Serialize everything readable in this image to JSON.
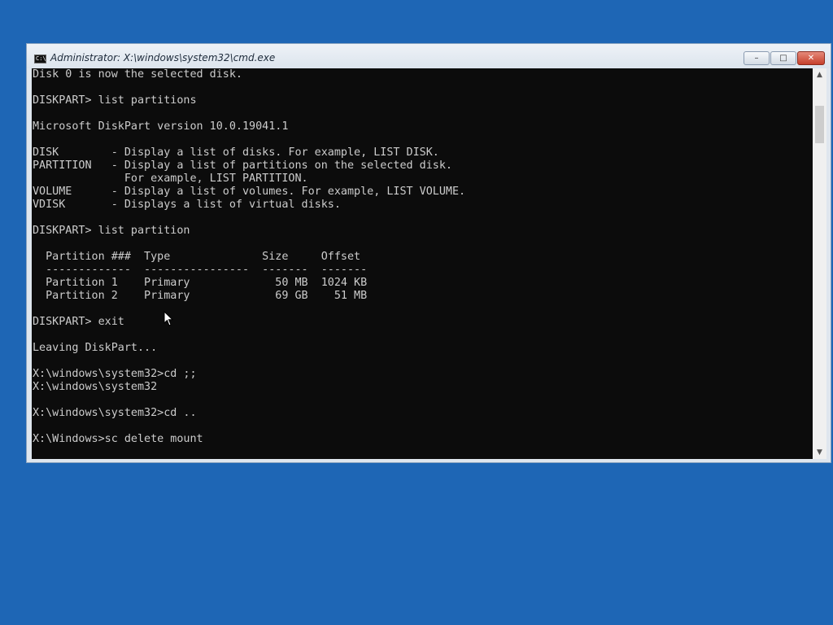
{
  "window": {
    "title": "Administrator: X:\\windows\\system32\\cmd.exe",
    "icon_label": "C:\\",
    "min_glyph": "–",
    "max_glyph": "□",
    "close_glyph": "✕"
  },
  "terminal": {
    "lines": [
      "Disk 0 is now the selected disk.",
      "",
      "DISKPART> list partitions",
      "",
      "Microsoft DiskPart version 10.0.19041.1",
      "",
      "DISK        - Display a list of disks. For example, LIST DISK.",
      "PARTITION   - Display a list of partitions on the selected disk.",
      "              For example, LIST PARTITION.",
      "VOLUME      - Display a list of volumes. For example, LIST VOLUME.",
      "VDISK       - Displays a list of virtual disks.",
      "",
      "DISKPART> list partition",
      "",
      "  Partition ###  Type              Size     Offset",
      "  -------------  ----------------  -------  -------",
      "  Partition 1    Primary             50 MB  1024 KB",
      "  Partition 2    Primary             69 GB    51 MB",
      "",
      "DISKPART> exit",
      "",
      "Leaving DiskPart...",
      "",
      "X:\\windows\\system32>cd ;;",
      "X:\\windows\\system32",
      "",
      "X:\\windows\\system32>cd ..",
      "",
      "X:\\Windows>sc delete mount"
    ]
  },
  "scrollbar": {
    "up_glyph": "▲",
    "down_glyph": "▼"
  },
  "colors": {
    "desktop": "#1e66b5",
    "terminal_bg": "#0c0c0c",
    "terminal_fg": "#cccccc"
  }
}
